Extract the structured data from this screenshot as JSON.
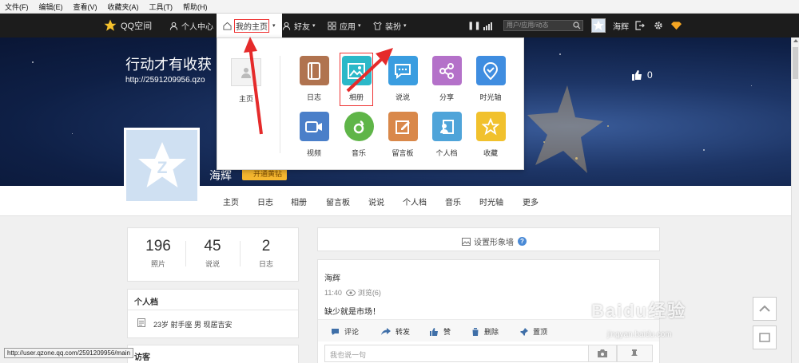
{
  "menubar": [
    "文件(F)",
    "编辑(E)",
    "查看(V)",
    "收藏夹(A)",
    "工具(T)",
    "帮助(H)"
  ],
  "topbar": {
    "logo": "QQ空间",
    "personal_center": "个人中心",
    "my_home": "我的主页",
    "friends": "好友",
    "apps": "应用",
    "dress": "装扮",
    "search_placeholder": "用户/应用/动态",
    "username": "海辉"
  },
  "banner": {
    "title": "行动才有收获",
    "url": "http://2591209956.qzo",
    "likes": "0",
    "name": "海辉",
    "vip": "开通黄钻"
  },
  "dropdown": {
    "home_label": "主页",
    "apps": [
      {
        "label": "日志",
        "color": "#b0734f",
        "icon": "diary-icon"
      },
      {
        "label": "相册",
        "color": "#2bb8c8",
        "icon": "photo-album-icon"
      },
      {
        "label": "说说",
        "color": "#3a9de0",
        "icon": "chat-bubble-icon"
      },
      {
        "label": "分享",
        "color": "#b471c9",
        "icon": "share-icon"
      },
      {
        "label": "时光轴",
        "color": "#3f8de0",
        "icon": "timeline-icon"
      },
      {
        "label": "视频",
        "color": "#4a7fc9",
        "icon": "video-camera-icon"
      },
      {
        "label": "音乐",
        "color": "#5fb548",
        "icon": "music-icon"
      },
      {
        "label": "留言板",
        "color": "#d9884a",
        "icon": "message-board-icon"
      },
      {
        "label": "个人档",
        "color": "#4fa4d9",
        "icon": "profile-card-icon"
      },
      {
        "label": "收藏",
        "color": "#f1c12d",
        "icon": "star-icon"
      }
    ]
  },
  "nav": [
    "主页",
    "日志",
    "相册",
    "留言板",
    "说说",
    "个人档",
    "音乐",
    "时光轴",
    "更多"
  ],
  "stats": [
    {
      "n": "196",
      "l": "照片"
    },
    {
      "n": "45",
      "l": "说说"
    },
    {
      "n": "2",
      "l": "日志"
    }
  ],
  "profile_card": {
    "title": "个人档",
    "info": "23岁 射手座 男 现居吉安"
  },
  "visitors_title": "访客",
  "feed": {
    "set_wall": "设置形象墙",
    "author": "海辉",
    "time": "11:40",
    "views": "浏览(6)",
    "content": "缺少就是市场！",
    "actions": [
      "评论",
      "转发",
      "赞",
      "删除",
      "置顶"
    ],
    "comment_placeholder": "我也说一句"
  },
  "status_url": "http://user.qzone.qq.com/2591209956/main",
  "watermark": {
    "brand": "Baidu经验",
    "url": "jingyan.baidu.com"
  }
}
